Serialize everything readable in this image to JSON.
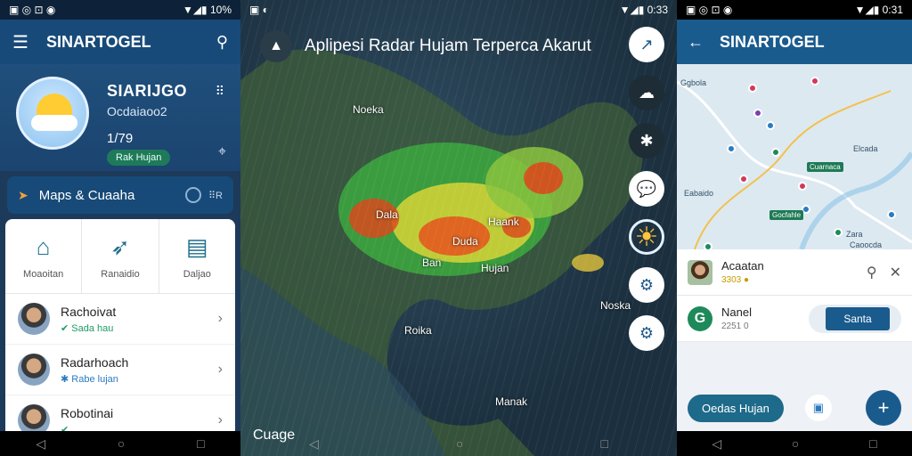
{
  "phone1": {
    "status": {
      "left_icons": "▣ ◎ ⊡ ◉",
      "right_text": "▼◢▮ 10%"
    },
    "appbar": {
      "title": "SINARTOGEL",
      "menu_icon": "☰",
      "search_icon": "⚲"
    },
    "hero": {
      "name": "SIARIJGO",
      "sub": "Ocdaiaoo2",
      "temp": "1/79",
      "pill": "Rak Hujan",
      "qr": "⠿",
      "gps": "⌖"
    },
    "maps_card": {
      "label": "Maps & Cuaaha",
      "mini": "⠿R"
    },
    "quick_actions": [
      {
        "icon": "⌂",
        "label": "Moaoitan"
      },
      {
        "icon": "➶",
        "label": "Ranaidio"
      },
      {
        "icon": "▤",
        "label": "Daljao"
      }
    ],
    "rows": [
      {
        "name": "Rachoivat",
        "status": "Sada hau",
        "status_color": "green"
      },
      {
        "name": "Radarhoach",
        "status": "Rabe lujan",
        "status_color": "blue"
      },
      {
        "name": "Robotinai",
        "status": "...",
        "status_color": "green"
      }
    ]
  },
  "phone2": {
    "status": {
      "left_icons": "▣ ◐",
      "right_text": "▼◢▮ 0:33"
    },
    "title": "Aplipesi Radar Hujam Terperca Akarut",
    "labels": [
      "Noeka",
      "Dala",
      "Haank",
      "Duda",
      "Ban",
      "Hujan",
      "Roika",
      "Noska",
      "Manak"
    ],
    "bottom_text": "Cuage",
    "fab_icons": [
      "↗",
      "☁",
      "✱",
      "💬",
      "☀",
      "⚙",
      "⚙"
    ]
  },
  "phone3": {
    "status": {
      "left_icons": "▣ ◎ ⊡ ◉",
      "right_text": "▼◢▮ 0:31"
    },
    "appbar": {
      "title": "SINARTOGEL",
      "back_icon": "←"
    },
    "map_labels": [
      "Ggbola",
      "Elcada",
      "Eabaido",
      "Cuarnaca",
      "Gocfahle",
      "Zara",
      "Caoocda"
    ],
    "rows": [
      {
        "name": "Acaatan",
        "status": "3303 ●"
      },
      {
        "name": "Nanel",
        "status": "2251 0",
        "button": "Santa"
      }
    ],
    "bottom": {
      "pill": "Oedas Hujan",
      "square": "▣",
      "add": "+"
    }
  },
  "nav": {
    "back": "◁",
    "home": "○",
    "recent": "□"
  }
}
